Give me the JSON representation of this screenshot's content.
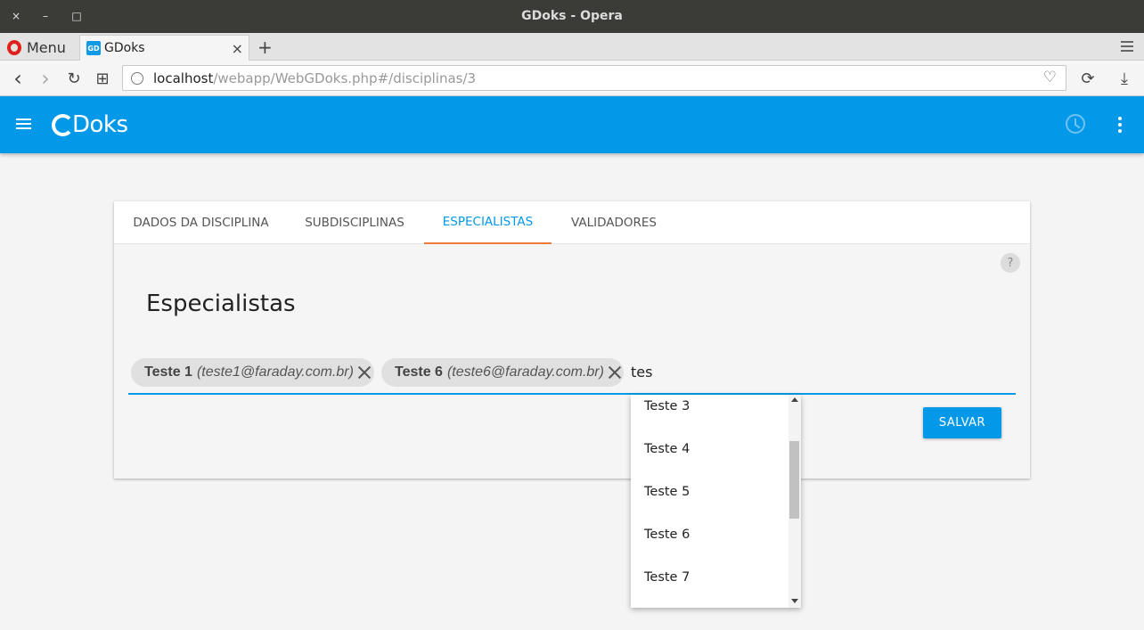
{
  "window": {
    "title": "GDoks - Opera",
    "close_glyph": "×",
    "minimize_glyph": "–",
    "maximize_glyph": "□"
  },
  "browser": {
    "menu_label": "Menu",
    "tab_title": "GDoks",
    "tab_close_glyph": "×",
    "new_tab_glyph": "+",
    "url_host": "localhost",
    "url_path": "/webapp/WebGDoks.php#/disciplinas/3",
    "back_glyph": "‹",
    "forward_glyph": "›",
    "reload_glyph": "↻",
    "grid_glyph": "⊞",
    "heart_glyph": "♡",
    "sync_glyph": "⟳",
    "download_glyph": "⤓"
  },
  "app": {
    "logo_text": "Doks",
    "accent_color": "#0399e8",
    "tab_indicator_color": "#f07a3a"
  },
  "tabs": [
    {
      "label": "DADOS DA DISCIPLINA",
      "active": false
    },
    {
      "label": "SUBDISCIPLINAS",
      "active": false
    },
    {
      "label": "ESPECIALISTAS",
      "active": true
    },
    {
      "label": "VALIDADORES",
      "active": false
    }
  ],
  "help_glyph": "?",
  "section_title": "Especialistas",
  "chips": [
    {
      "name": "Teste 1",
      "email": "(teste1@faraday.com.br)"
    },
    {
      "name": "Teste 6",
      "email": "(teste6@faraday.com.br)"
    }
  ],
  "search_input": "tes",
  "save_label": "SALVAR",
  "dropdown": {
    "items": [
      "Teste 3",
      "Teste 4",
      "Teste 5",
      "Teste 6",
      "Teste 7"
    ]
  }
}
